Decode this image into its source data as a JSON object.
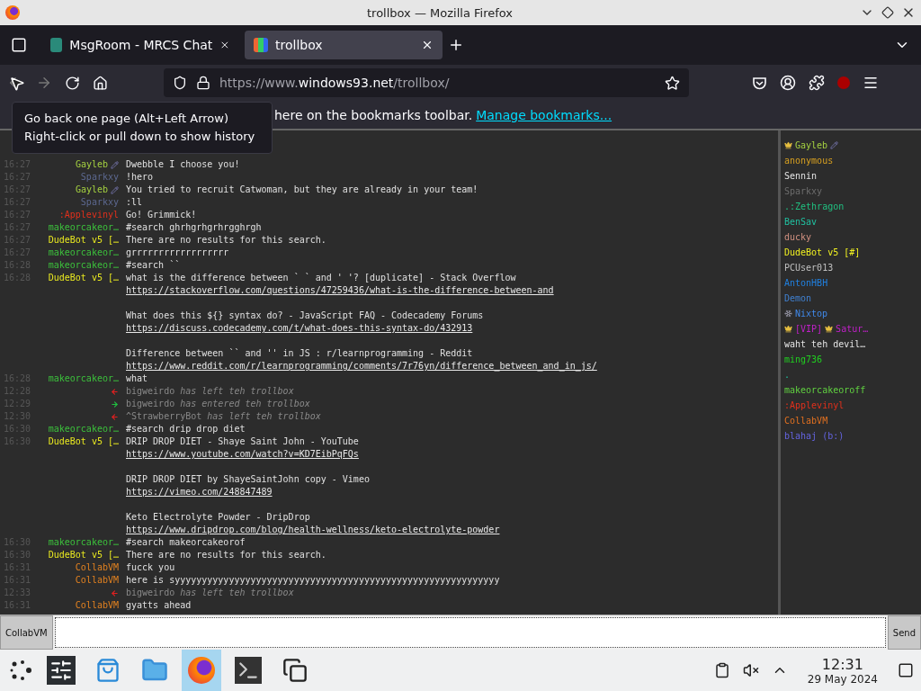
{
  "window": {
    "title": "trollbox — Mozilla Firefox"
  },
  "tabs": [
    {
      "title": "MsgRoom - MRCS Chat",
      "selected": false
    },
    {
      "title": "trollbox",
      "selected": true
    }
  ],
  "address": {
    "prefix": "https://www.",
    "host": "windows93.net",
    "path": "/trollbox/"
  },
  "bookmarks_bar": {
    "text": "here on the bookmarks toolbar.",
    "link": "Manage bookmarks..."
  },
  "tooltip": {
    "lines": [
      "Go back one page (Alt+Left Arrow)",
      "Right-click or pull down to show history"
    ]
  },
  "chat": [
    {
      "kind": "message",
      "time": "16:27",
      "nick": "Gayleb",
      "color": "#a4d040",
      "pencil": true,
      "body": [
        {
          "kind": "text",
          "text": "Dwebble I choose you!"
        }
      ]
    },
    {
      "kind": "message",
      "time": "16:27",
      "nick": "Sparkxy",
      "color": "#5c6890",
      "body": [
        {
          "kind": "text",
          "text": "!hero"
        }
      ]
    },
    {
      "kind": "message",
      "time": "16:27",
      "nick": "Gayleb",
      "color": "#a4d040",
      "pencil": true,
      "body": [
        {
          "kind": "text",
          "text": "You tried to recruit Catwoman, but they are already in your team!"
        }
      ]
    },
    {
      "kind": "message",
      "time": "16:27",
      "nick": "Sparkxy",
      "color": "#5c6890",
      "body": [
        {
          "kind": "text",
          "text": ":ll"
        }
      ]
    },
    {
      "kind": "message",
      "time": "16:27",
      "nick": ":Applevinyl",
      "color": "#e0301c",
      "body": [
        {
          "kind": "text",
          "text": "Go! Grimmick!"
        }
      ]
    },
    {
      "kind": "message",
      "time": "16:27",
      "nick": "makeorcakeor…",
      "color": "#3cc03c",
      "body": [
        {
          "kind": "text",
          "text": "#search ghrhgrhgrhrgghrgh"
        }
      ]
    },
    {
      "kind": "message",
      "time": "16:27",
      "nick": "DudeBot v5 […",
      "color": "#e8e820",
      "body": [
        {
          "kind": "text",
          "text": "There are no results for this search."
        }
      ]
    },
    {
      "kind": "message",
      "time": "16:27",
      "nick": "makeorcakeor…",
      "color": "#3cc03c",
      "body": [
        {
          "kind": "text",
          "text": "grrrrrrrrrrrrrrrrrr"
        }
      ]
    },
    {
      "kind": "message",
      "time": "16:28",
      "nick": "makeorcakeor…",
      "color": "#3cc03c",
      "body": [
        {
          "kind": "text",
          "text": "#search ``"
        }
      ]
    },
    {
      "kind": "message",
      "time": "16:28",
      "nick": "DudeBot v5 […",
      "color": "#e8e820",
      "body": [
        {
          "kind": "text",
          "text": "what is the difference between ` ` and ' '? [duplicate] - Stack Overflow"
        },
        {
          "kind": "link",
          "text": "https://stackoverflow.com/questions/47259436/what-is-the-difference-between-and"
        },
        {
          "kind": "gap"
        },
        {
          "kind": "text",
          "text": "What does this ${} syntax do? - JavaScript FAQ - Codecademy Forums"
        },
        {
          "kind": "link",
          "text": "https://discuss.codecademy.com/t/what-does-this-syntax-do/432913"
        },
        {
          "kind": "gap"
        },
        {
          "kind": "text",
          "text": "Difference between `` and '' in JS : r/learnprogramming - Reddit"
        },
        {
          "kind": "link",
          "text": "https://www.reddit.com/r/learnprogramming/comments/7r76yn/difference_between_and_in_js/"
        }
      ]
    },
    {
      "kind": "message",
      "time": "16:28",
      "nick": "makeorcakeor…",
      "color": "#3cc03c",
      "body": [
        {
          "kind": "text",
          "text": "what"
        }
      ]
    },
    {
      "kind": "leave",
      "time": "12:28",
      "user": "bigweirdo",
      "action": "has left teh trollbox"
    },
    {
      "kind": "join",
      "time": "12:29",
      "user": "bigweirdo",
      "action": "has entered teh trollbox"
    },
    {
      "kind": "leave",
      "time": "12:30",
      "user": "^StrawberryBot",
      "action": "has left teh trollbox"
    },
    {
      "kind": "message",
      "time": "16:30",
      "nick": "makeorcakeor…",
      "color": "#3cc03c",
      "body": [
        {
          "kind": "text",
          "text": "#search drip drop diet"
        }
      ]
    },
    {
      "kind": "message",
      "time": "16:30",
      "nick": "DudeBot v5 […",
      "color": "#e8e820",
      "body": [
        {
          "kind": "text",
          "text": "DRIP DROP DIET - Shaye Saint John - YouTube"
        },
        {
          "kind": "link",
          "text": "https://www.youtube.com/watch?v=KD7EibPqFQs"
        },
        {
          "kind": "gap"
        },
        {
          "kind": "text",
          "text": "DRIP DROP DIET by ShayeSaintJohn copy - Vimeo"
        },
        {
          "kind": "link",
          "text": "https://vimeo.com/248847489"
        },
        {
          "kind": "gap"
        },
        {
          "kind": "text",
          "text": "Keto Electrolyte Powder - DripDrop"
        },
        {
          "kind": "link",
          "text": "https://www.dripdrop.com/blog/health-wellness/keto-electrolyte-powder"
        }
      ]
    },
    {
      "kind": "message",
      "time": "16:30",
      "nick": "makeorcakeor…",
      "color": "#3cc03c",
      "body": [
        {
          "kind": "text",
          "text": "#search makeorcakeorof"
        }
      ]
    },
    {
      "kind": "message",
      "time": "16:30",
      "nick": "DudeBot v5 […",
      "color": "#e8e820",
      "body": [
        {
          "kind": "text",
          "text": "There are no results for this search."
        }
      ]
    },
    {
      "kind": "message",
      "time": "16:31",
      "nick": "CollabVM",
      "color": "#e08020",
      "body": [
        {
          "kind": "text",
          "text": "fucck you"
        }
      ]
    },
    {
      "kind": "message",
      "time": "16:31",
      "nick": "CollabVM",
      "color": "#e08020",
      "body": [
        {
          "kind": "text",
          "text": "here is syyyyyyyyyyyyyyyyyyyyyyyyyyyyyyyyyyyyyyyyyyyyyyyyyyyyyyyyyyyy"
        }
      ]
    },
    {
      "kind": "leave",
      "time": "12:33",
      "user": "bigweirdo",
      "action": "has left teh trollbox"
    },
    {
      "kind": "message",
      "time": "16:31",
      "nick": "CollabVM",
      "color": "#e08020",
      "body": [
        {
          "kind": "text",
          "text": "gyatts ahead"
        }
      ]
    }
  ],
  "users": [
    {
      "name": "Gayleb",
      "color": "#a4d040",
      "kind": "moderator"
    },
    {
      "name": "anonymous",
      "color": "#d8a020"
    },
    {
      "name": "Sennin",
      "color": "#e4e4e4"
    },
    {
      "name": "Sparkxy",
      "color": "#6c6c6c"
    },
    {
      "name": ".:Zethragon",
      "color": "#20c080"
    },
    {
      "name": "BenSav",
      "color": "#20c0a0"
    },
    {
      "name": "ducky",
      "color": "#d09080"
    },
    {
      "name": "DudeBot v5 [#]",
      "color": "#f0f020"
    },
    {
      "name": "PCUser013",
      "color": "#c0c0c0"
    },
    {
      "name": "AntonHBH",
      "color": "#2080e0"
    },
    {
      "name": "Demon",
      "color": "#4080d0"
    },
    {
      "name": "Nixtop",
      "color": "#4088e8",
      "kind": "snowflake"
    },
    {
      "name": "[VIP]",
      "color": "#c020c8",
      "kind": "vip",
      "suffix_name": "Satur…"
    },
    {
      "name": "waht teh devil…",
      "color": "#e4e4e4"
    },
    {
      "name": "ming736",
      "color": "#20d020"
    },
    {
      "name": "."
    },
    {
      "name": "makeorcakeoroff",
      "color": "#60d040"
    },
    {
      "name": ":Applevinyl",
      "color": "#e0301c"
    },
    {
      "name": "CollabVM",
      "color": "#e07020"
    },
    {
      "name": "blahaj (b:)",
      "color": "#6464e0"
    }
  ],
  "input": {
    "nick": "CollabVM",
    "send": "Send"
  },
  "taskbar": {
    "tasks": [
      {
        "kind": "settings",
        "selected": false
      },
      {
        "kind": "store",
        "selected": false
      },
      {
        "kind": "files",
        "selected": false
      },
      {
        "kind": "browser",
        "selected": true
      },
      {
        "kind": "terminal",
        "selected": false
      },
      {
        "kind": "windows",
        "selected": false
      }
    ],
    "time": "12:31",
    "date": "29 May 2024"
  }
}
